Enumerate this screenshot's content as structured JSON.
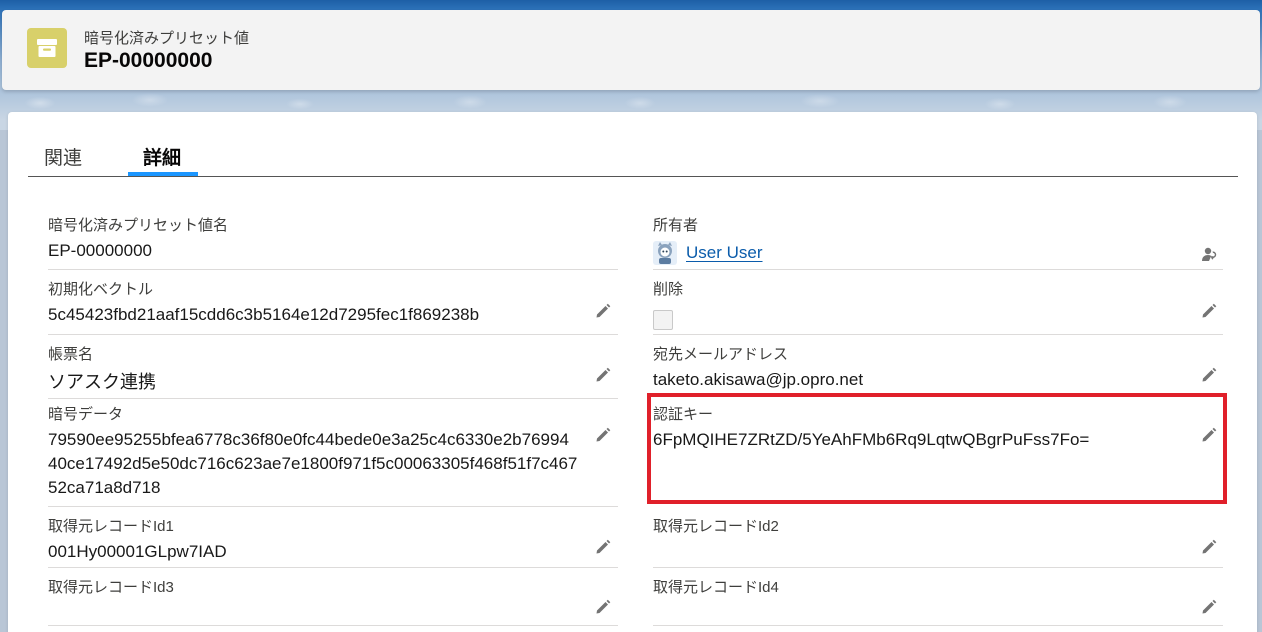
{
  "header": {
    "object_type": "暗号化済みプリセット値",
    "record_name": "EP-00000000",
    "icon": "archive-box-icon",
    "icon_color": "#d8d06a"
  },
  "tabs": [
    {
      "label": "関連",
      "active": false
    },
    {
      "label": "詳細",
      "active": true
    }
  ],
  "fields": {
    "name": {
      "label": "暗号化済みプリセット値名",
      "value": "EP-00000000"
    },
    "owner": {
      "label": "所有者",
      "value": "User User"
    },
    "iv": {
      "label": "初期化ベクトル",
      "value": "5c45423fbd21aaf15cdd6c3b5164e12d7295fec1f869238b"
    },
    "deleted": {
      "label": "削除",
      "checked": false
    },
    "form_name": {
      "label": "帳票名",
      "value": "ソアスク連携"
    },
    "email": {
      "label": "宛先メールアドレス",
      "value": "taketo.akisawa@jp.opro.net"
    },
    "encrypted_data": {
      "label": "暗号データ",
      "value": "79590ee95255bfea6778c36f80e0fc44bede0e3a25c4c6330e2b7699440ce17492d5e50dc716c623ae7e1800f971f5c00063305f468f51f7c46752ca71a8d718"
    },
    "auth_key": {
      "label": "認証キー",
      "value": "6FpMQIHE7ZRtZD/5YeAhFMb6Rq9LqtwQBgrPuFss7Fo="
    },
    "source_id1": {
      "label": "取得元レコードId1",
      "value": "001Hy00001GLpw7IAD"
    },
    "source_id2": {
      "label": "取得元レコードId2",
      "value": ""
    },
    "source_id3": {
      "label": "取得元レコードId3",
      "value": ""
    },
    "source_id4": {
      "label": "取得元レコードId4",
      "value": ""
    }
  },
  "colors": {
    "accent": "#1b96ff",
    "link": "#0b5cab",
    "highlight": "#e0202a"
  }
}
